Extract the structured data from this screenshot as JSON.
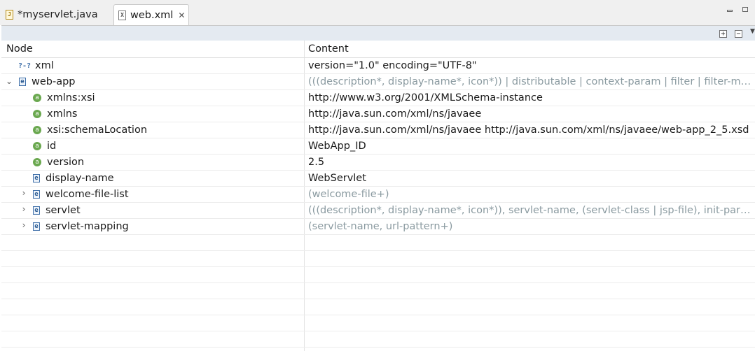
{
  "tabs": [
    {
      "label": "*myservlet.java",
      "icon": "java-file-icon",
      "active": false
    },
    {
      "label": "web.xml",
      "icon": "xml-file-icon",
      "active": true
    }
  ],
  "tab_close_glyph": "✕",
  "table": {
    "headers": {
      "node": "Node",
      "content": "Content"
    },
    "rows": [
      {
        "node": "xml",
        "content": "version=\"1.0\" encoding=\"UTF-8\""
      },
      {
        "node": "web-app",
        "content": "(((description*, display-name*, icon*)) | distributable | context-param | filter | filter-map..."
      },
      {
        "node": "xmlns:xsi",
        "content": "http://www.w3.org/2001/XMLSchema-instance"
      },
      {
        "node": "xmlns",
        "content": "http://java.sun.com/xml/ns/javaee"
      },
      {
        "node": "xsi:schemaLocation",
        "content": "http://java.sun.com/xml/ns/javaee http://java.sun.com/xml/ns/javaee/web-app_2_5.xsd"
      },
      {
        "node": "id",
        "content": "WebApp_ID"
      },
      {
        "node": "version",
        "content": "2.5"
      },
      {
        "node": "display-name",
        "content": "WebServlet"
      },
      {
        "node": "welcome-file-list",
        "content": "(welcome-file+)"
      },
      {
        "node": "servlet",
        "content": "(((description*, display-name*, icon*)), servlet-name, (servlet-class | jsp-file), init-param..."
      },
      {
        "node": "servlet-mapping",
        "content": "(servlet-name, url-pattern+)"
      }
    ]
  },
  "colors": {
    "accent_toolbar": "#e4eaf1",
    "attr_icon": "#6aa84f",
    "element_icon": "#3d6ea8",
    "gray_text": "#8a9aa0"
  }
}
